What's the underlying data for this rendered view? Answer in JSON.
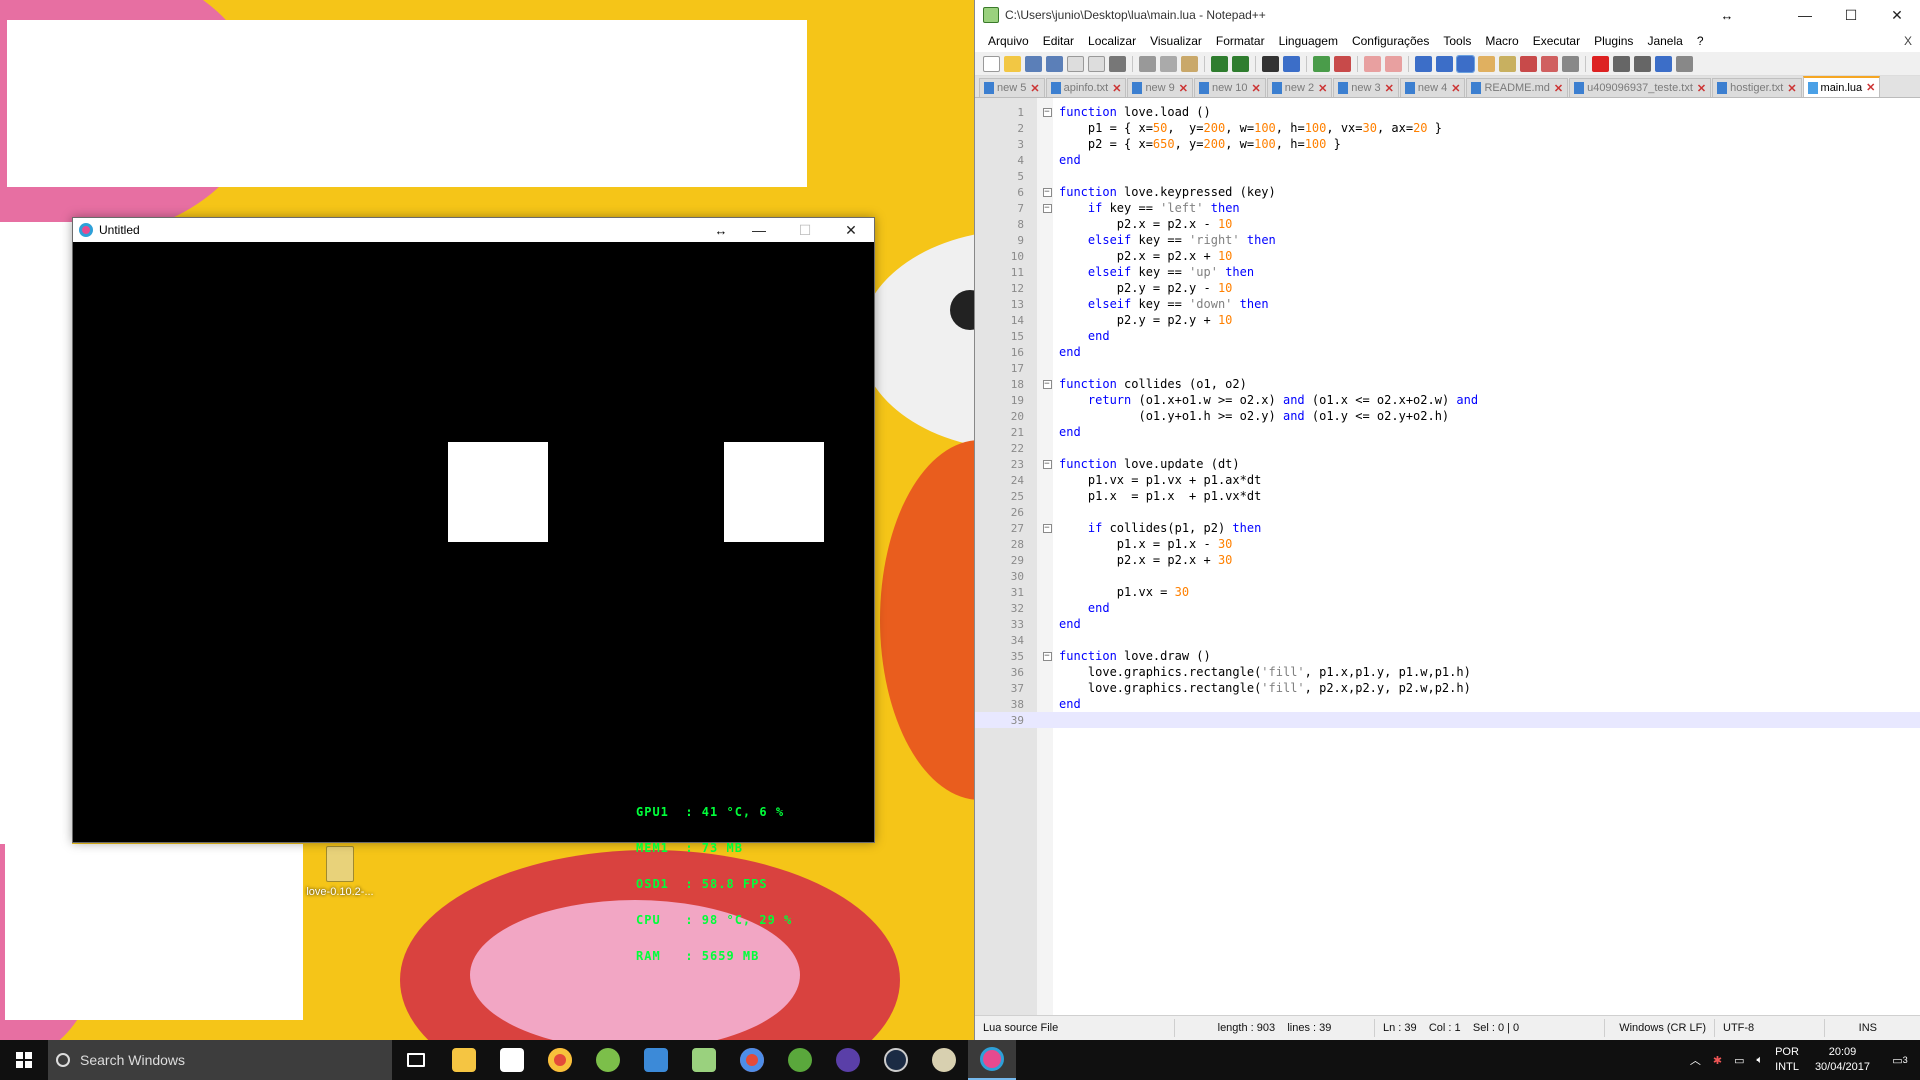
{
  "desktop": {
    "icons": [
      {
        "label": "love-0.10.2-..."
      }
    ]
  },
  "love_window": {
    "title": "Untitled",
    "osd_lines": [
      "GPU1  : 41 °C, 6 %",
      "MEM1  : 73 MB",
      "OSD1  : 58.8 FPS",
      "CPU   : 98 °C, 29 %",
      "RAM   : 5659 MB"
    ]
  },
  "notepad": {
    "title": "C:\\Users\\junio\\Desktop\\lua\\main.lua - Notepad++",
    "menu": [
      "Arquivo",
      "Editar",
      "Localizar",
      "Visualizar",
      "Formatar",
      "Linguagem",
      "Configurações",
      "Tools",
      "Macro",
      "Executar",
      "Plugins",
      "Janela",
      "?"
    ],
    "menu_close": "X",
    "tabs": [
      {
        "label": "new 5",
        "active": false
      },
      {
        "label": "apinfo.txt",
        "active": false
      },
      {
        "label": "new 9",
        "active": false
      },
      {
        "label": "new 10",
        "active": false
      },
      {
        "label": "new 2",
        "active": false
      },
      {
        "label": "new 3",
        "active": false
      },
      {
        "label": "new 4",
        "active": false
      },
      {
        "label": "README.md",
        "active": false
      },
      {
        "label": "u409096937_teste.txt",
        "active": false
      },
      {
        "label": "hostiger.txt",
        "active": false
      },
      {
        "label": "main.lua",
        "active": true
      }
    ],
    "code_lines": [
      "function love.load ()",
      "    p1 = { x=50,  y=200, w=100, h=100, vx=30, ax=20 }",
      "    p2 = { x=650, y=200, w=100, h=100 }",
      "end",
      "",
      "function love.keypressed (key)",
      "    if key == 'left' then",
      "        p2.x = p2.x - 10",
      "    elseif key == 'right' then",
      "        p2.x = p2.x + 10",
      "    elseif key == 'up' then",
      "        p2.y = p2.y - 10",
      "    elseif key == 'down' then",
      "        p2.y = p2.y + 10",
      "    end",
      "end",
      "",
      "function collides (o1, o2)",
      "    return (o1.x+o1.w >= o2.x) and (o1.x <= o2.x+o2.w) and",
      "           (o1.y+o1.h >= o2.y) and (o1.y <= o2.y+o2.h)",
      "end",
      "",
      "function love.update (dt)",
      "    p1.vx = p1.vx + p1.ax*dt",
      "    p1.x  = p1.x  + p1.vx*dt",
      "",
      "    if collides(p1, p2) then",
      "        p1.x = p1.x - 30",
      "        p2.x = p2.x + 30",
      "",
      "        p1.vx = 30",
      "    end",
      "end",
      "",
      "function love.draw ()",
      "    love.graphics.rectangle('fill', p1.x,p1.y, p1.w,p1.h)",
      "    love.graphics.rectangle('fill', p2.x,p2.y, p2.w,p2.h)",
      "end",
      ""
    ],
    "fold_markers": {
      "1": "minus",
      "6": "minus",
      "7": "minus",
      "18": "minus",
      "23": "minus",
      "27": "minus",
      "35": "minus"
    },
    "current_line": 39,
    "status": {
      "file_type": "Lua source File",
      "length_lines": "length : 903    lines : 39",
      "position": "Ln : 39    Col : 1    Sel : 0 | 0",
      "eol": "Windows (CR LF)",
      "encoding": "UTF-8",
      "mode": "INS"
    }
  },
  "taskbar": {
    "search_placeholder": "Search Windows",
    "lang_top": "POR",
    "lang_bottom": "INTL",
    "time": "20:09",
    "date": "30/04/2017",
    "notification_count": "3"
  },
  "colors": {
    "wallpaper": "#f5c518",
    "osd_text": "#00ff3a",
    "lua_keyword": "#0000ff",
    "lua_number": "#ff8000",
    "lua_string": "#808080"
  }
}
